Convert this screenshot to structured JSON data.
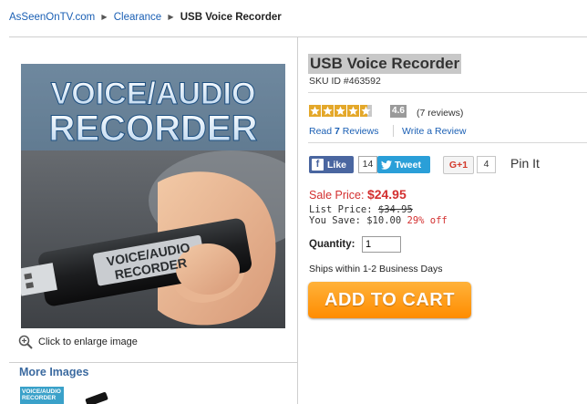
{
  "breadcrumb": {
    "home": "AsSeenOnTV.com",
    "category": "Clearance",
    "current": "USB Voice Recorder"
  },
  "product_image": {
    "banner_line1": "VOICE/AUDIO",
    "banner_line2": "RECORDER",
    "device_label_line1": "VOICE/AUDIO",
    "device_label_line2": "RECORDER"
  },
  "enlarge_label": "Click to enlarge image",
  "more_images_label": "More Images",
  "thumbnail_text": "VOICE/AUDIO RECORDER",
  "product": {
    "title": "USB Voice Recorder",
    "sku": "SKU ID #463592",
    "rating": 4.6,
    "rating_label": "4.6",
    "review_count": "(7 reviews)",
    "read_reviews_prefix": "Read ",
    "read_reviews_count": "7",
    "read_reviews_suffix": " Reviews",
    "write_review": "Write a Review"
  },
  "social": {
    "fb_icon": "f",
    "fb_like": "Like",
    "fb_count": "14",
    "tweet": "Tweet",
    "gplus": "G+1",
    "gplus_count": "4",
    "pin_it": "Pin It"
  },
  "pricing": {
    "sale_label": "Sale Price:",
    "sale_price": "$24.95",
    "list_label": "List Price:",
    "list_price": "$34.95",
    "save_label": "You Save:",
    "save_amount": "$10.00",
    "save_percent": "29% off"
  },
  "purchase": {
    "quantity_label": "Quantity:",
    "quantity_value": "1",
    "shipping": "Ships within 1-2 Business Days",
    "add_to_cart": "ADD TO CART"
  },
  "colors": {
    "link": "#1a5fb4",
    "sale_red": "#d32f2f",
    "star_gold": "#e4a82a",
    "cart_orange": "#ff8c00",
    "facebook": "#4a66a0",
    "twitter": "#2a9fd8"
  },
  "icons": {
    "breadcrumb_separator": "triangle-right-icon",
    "zoom": "magnifier-plus-icon",
    "star": "star-icon",
    "twitter": "twitter-bird-icon",
    "facebook": "facebook-f-icon"
  }
}
